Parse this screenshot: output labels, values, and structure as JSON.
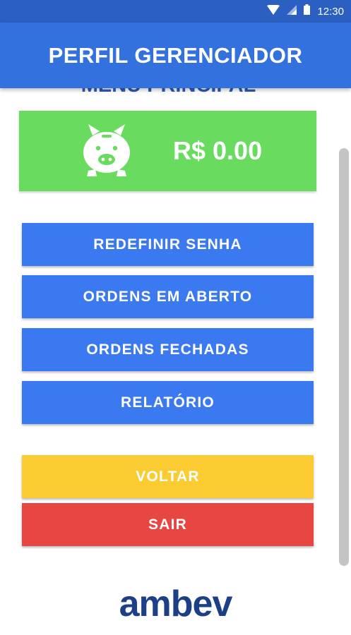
{
  "status_bar": {
    "time": "12:30",
    "icons": [
      "wifi-icon",
      "signal-icon",
      "battery-icon"
    ]
  },
  "app_bar": {
    "title": "PERFIL GERENCIADOR"
  },
  "menu": {
    "section_title": "MENU PRINCIPAL",
    "balance": {
      "icon": "piggy-bank-icon",
      "value": "R$ 0.00"
    },
    "buttons": [
      {
        "label": "REDEFINIR SENHA"
      },
      {
        "label": "ORDENS EM ABERTO"
      },
      {
        "label": "ORDENS FECHADAS"
      },
      {
        "label": "RELATÓRIO"
      },
      {
        "label": "VOLTAR"
      },
      {
        "label": "SAIR"
      }
    ]
  },
  "footer": {
    "logo_text": "ambev"
  },
  "colors": {
    "status_bar": "#2b5fc1",
    "app_bar": "#3371de",
    "balance_card": "#69db5f",
    "button_blue": "#3a79ef",
    "button_yellow": "#fbcc32",
    "button_red": "#e84643",
    "logo": "#1c3f86"
  }
}
